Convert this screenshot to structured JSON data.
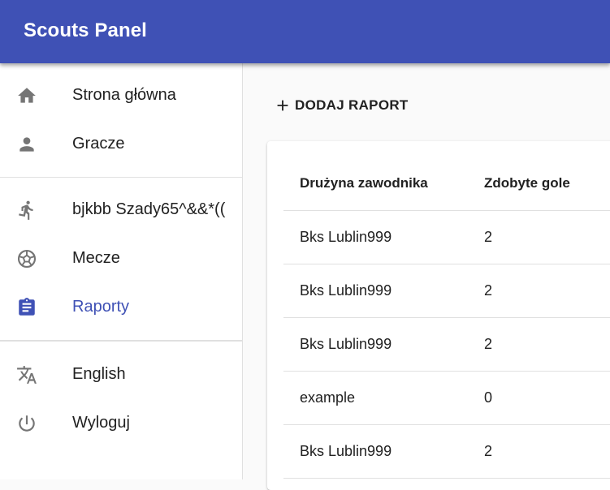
{
  "app": {
    "title": "Scouts Panel"
  },
  "sidebar": {
    "items": [
      {
        "label": "Strona główna",
        "icon": "home-icon"
      },
      {
        "label": "Gracze",
        "icon": "person-icon"
      },
      {
        "label": "bjkbb Szady65^&&*((",
        "icon": "running-person-icon"
      },
      {
        "label": "Mecze",
        "icon": "soccer-ball-icon"
      },
      {
        "label": "Raporty",
        "icon": "clipboard-icon",
        "active": true
      },
      {
        "label": "English",
        "icon": "translate-icon"
      },
      {
        "label": "Wyloguj",
        "icon": "power-icon"
      }
    ]
  },
  "main": {
    "add_button_label": "DODAJ RAPORT",
    "table": {
      "columns": [
        "Drużyna zawodnika",
        "Zdobyte gole"
      ],
      "rows": [
        [
          "Bks Lublin999",
          "2"
        ],
        [
          "Bks Lublin999",
          "2"
        ],
        [
          "Bks Lublin999",
          "2"
        ],
        [
          "example",
          "0"
        ],
        [
          "Bks Lublin999",
          "2"
        ]
      ]
    }
  },
  "colors": {
    "primary": "#3f51b5",
    "icon": "#757575",
    "divider": "#e0e0e0"
  }
}
